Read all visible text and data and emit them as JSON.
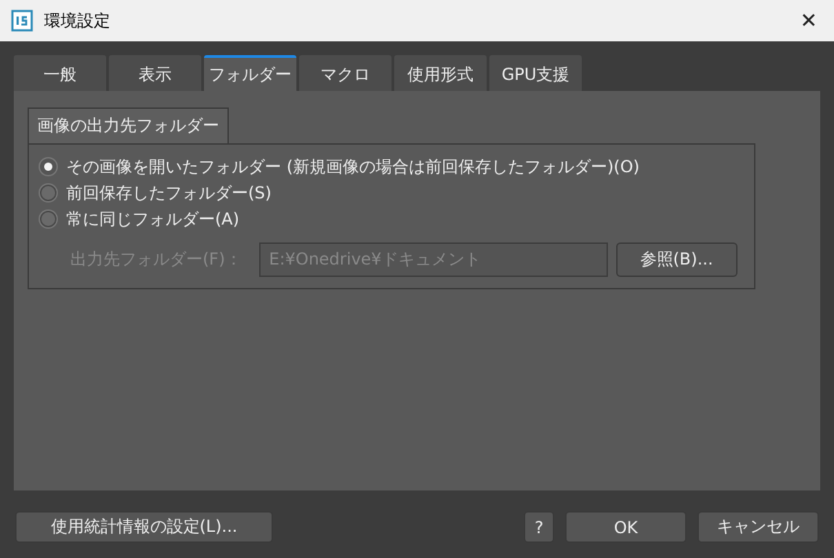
{
  "window": {
    "title": "環境設定",
    "close": "✕"
  },
  "tabs": [
    {
      "label": "一般",
      "selected": false
    },
    {
      "label": "表示",
      "selected": false
    },
    {
      "label": "フォルダー",
      "selected": true
    },
    {
      "label": "マクロ",
      "selected": false
    },
    {
      "label": "使用形式",
      "selected": false
    },
    {
      "label": "GPU支援",
      "selected": false
    }
  ],
  "group": {
    "title": "画像の出力先フォルダー",
    "options": [
      {
        "label": "その画像を開いたフォルダー (新規画像の場合は前回保存したフォルダー)(O)",
        "selected": true
      },
      {
        "label": "前回保存したフォルダー(S)",
        "selected": false
      },
      {
        "label": "常に同じフォルダー(A)",
        "selected": false
      }
    ],
    "output_folder": {
      "label": "出力先フォルダー(F)：",
      "value": "E:¥Onedrive¥ドキュメント",
      "disabled": true
    },
    "browse_button": "参照(B)..."
  },
  "footer": {
    "usage_button": "使用統計情報の設定(L)...",
    "help_button": "?",
    "ok_button": "OK",
    "cancel_button": "キャンセル"
  }
}
